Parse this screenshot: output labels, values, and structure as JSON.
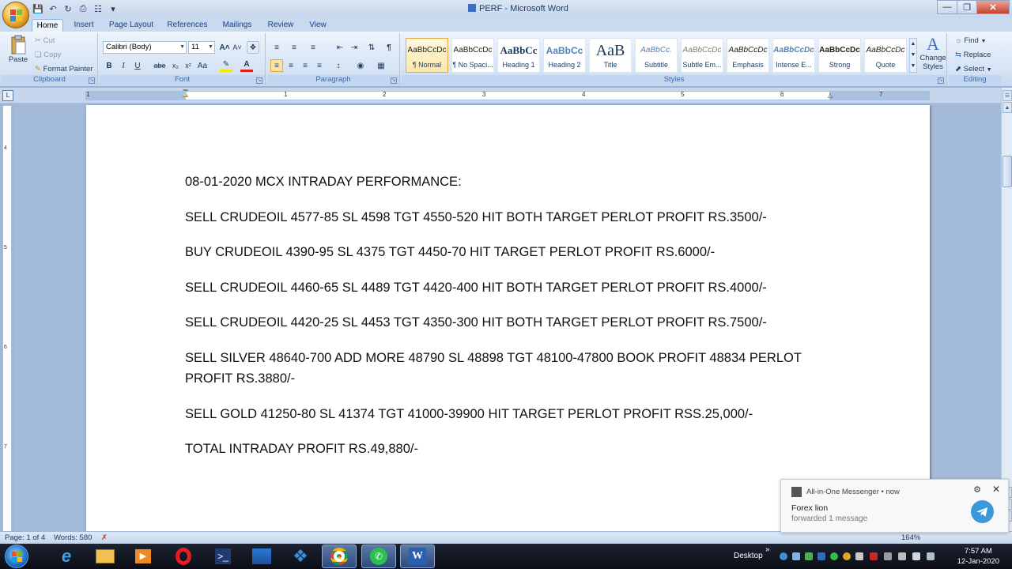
{
  "window": {
    "title": "PERF - Microsoft Word"
  },
  "tabs": [
    "Home",
    "Insert",
    "Page Layout",
    "References",
    "Mailings",
    "Review",
    "View"
  ],
  "ribbon": {
    "clipboard": {
      "paste": "Paste",
      "cut": "Cut",
      "copy": "Copy",
      "format_painter": "Format Painter",
      "label": "Clipboard"
    },
    "font": {
      "name": "Calibri (Body)",
      "size": "11",
      "label": "Font"
    },
    "paragraph": {
      "label": "Paragraph"
    },
    "styles": {
      "label": "Styles",
      "items": [
        {
          "preview": "AaBbCcDc",
          "name": "¶ Normal"
        },
        {
          "preview": "AaBbCcDc",
          "name": "¶ No Spaci..."
        },
        {
          "preview": "AaBbCc",
          "name": "Heading 1"
        },
        {
          "preview": "AaBbCc",
          "name": "Heading 2"
        },
        {
          "preview": "AaB",
          "name": "Title"
        },
        {
          "preview": "AaBbCc.",
          "name": "Subtitle"
        },
        {
          "preview": "AaBbCcDc",
          "name": "Subtle Em..."
        },
        {
          "preview": "AaBbCcDc",
          "name": "Emphasis"
        },
        {
          "preview": "AaBbCcDc",
          "name": "Intense E..."
        },
        {
          "preview": "AaBbCcDc",
          "name": "Strong"
        },
        {
          "preview": "AaBbCcDc",
          "name": "Quote"
        }
      ],
      "change_styles": "Change Styles"
    },
    "editing": {
      "find": "Find",
      "replace": "Replace",
      "select": "Select",
      "label": "Editing"
    }
  },
  "document": {
    "lines": [
      "08-01-2020 MCX INTRADAY PERFORMANCE:",
      "SELL CRUDEOIL 4577-85 SL 4598 TGT 4550-520 HIT BOTH TARGET PERLOT PROFIT RS.3500/-",
      "BUY CRUDEOIL 4390-95 SL 4375 TGT 4450-70 HIT TARGET PERLOT PROFIT RS.6000/-",
      "SELL CRUDEOIL 4460-65 SL 4489 TGT 4420-400 HIT BOTH TARGET PERLOT PROFIT RS.4000/-",
      "SELL CRUDEOIL 4420-25 SL 4453 TGT 4350-300 HIT BOTH TARGET PERLOT PROFIT RS.7500/-",
      "SELL SILVER  48640-700  ADD MORE 48790 SL 48898 TGT 48100-47800 BOOK PROFIT 48834 PERLOT PROFIT RS.3880/-",
      "SELL GOLD 41250-80 SL 41374 TGT 41000-39900 HIT TARGET PERLOT PROFIT RSS.25,000/-",
      "TOTAL INTRADAY PROFIT RS.49,880/-"
    ]
  },
  "status": {
    "page": "Page: 1 of 4",
    "words": "Words: 580",
    "zoom": "164%"
  },
  "notification": {
    "app": "All-in-One Messenger",
    "time": "now",
    "title": "Forex lion",
    "body": "forwarded 1 message"
  },
  "taskbar": {
    "desktop": "Desktop",
    "time": "7:57 AM",
    "date": "12-Jan-2020"
  }
}
